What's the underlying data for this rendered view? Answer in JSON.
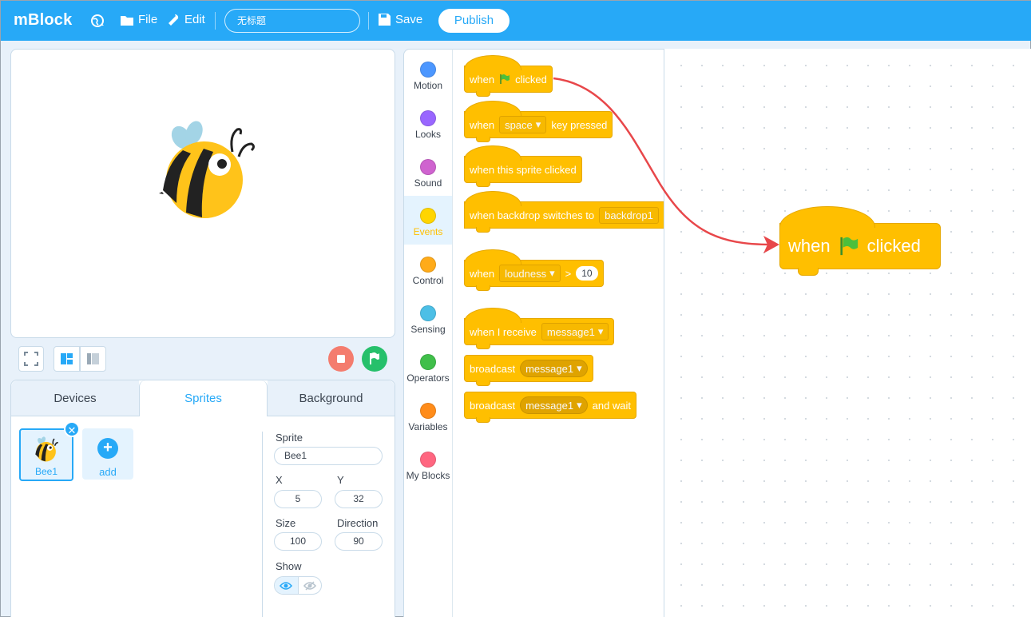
{
  "topbar": {
    "logo": "mBlock",
    "file_label": "File",
    "edit_label": "Edit",
    "project_title": "无标题",
    "save_label": "Save",
    "publish_label": "Publish"
  },
  "stage_tabs": [
    "Devices",
    "Sprites",
    "Background"
  ],
  "sprites": {
    "items": [
      {
        "name": "Bee1"
      }
    ],
    "add_label": "add"
  },
  "properties": {
    "sprite_label": "Sprite",
    "sprite_value": "Bee1",
    "x_label": "X",
    "x_value": "5",
    "y_label": "Y",
    "y_value": "32",
    "size_label": "Size",
    "size_value": "100",
    "direction_label": "Direction",
    "direction_value": "90",
    "show_label": "Show"
  },
  "categories": [
    {
      "label": "Motion",
      "color": "#4c97ff"
    },
    {
      "label": "Looks",
      "color": "#9966ff"
    },
    {
      "label": "Sound",
      "color": "#cf63cf"
    },
    {
      "label": "Events",
      "color": "#ffd500"
    },
    {
      "label": "Control",
      "color": "#ffab19"
    },
    {
      "label": "Sensing",
      "color": "#4cbfe6"
    },
    {
      "label": "Operators",
      "color": "#40bf4a"
    },
    {
      "label": "Variables",
      "color": "#ff8c1a"
    },
    {
      "label": "My Blocks",
      "color": "#ff6680"
    }
  ],
  "active_category": "Events",
  "blocks": {
    "flag_clicked": {
      "when": "when",
      "clicked": "clicked"
    },
    "key_pressed": {
      "when": "when",
      "key": "space",
      "suffix": "key pressed"
    },
    "sprite_clicked": {
      "text": "when this sprite clicked"
    },
    "backdrop": {
      "text": "when backdrop switches to",
      "value": "backdrop1"
    },
    "loudness": {
      "when": "when",
      "sensor": "loudness",
      "op": ">",
      "value": "10"
    },
    "receive": {
      "text": "when I receive",
      "value": "message1"
    },
    "broadcast": {
      "text": "broadcast",
      "value": "message1"
    },
    "broadcast_wait": {
      "text": "broadcast",
      "value": "message1",
      "suffix": "and wait"
    }
  },
  "workspace_block": {
    "when": "when",
    "clicked": "clicked"
  },
  "colors": {
    "accent": "#27a9f7",
    "events": "#ffbf00",
    "stop": "#f47c6e",
    "go": "#26c06b",
    "arrow": "#e8474a"
  }
}
